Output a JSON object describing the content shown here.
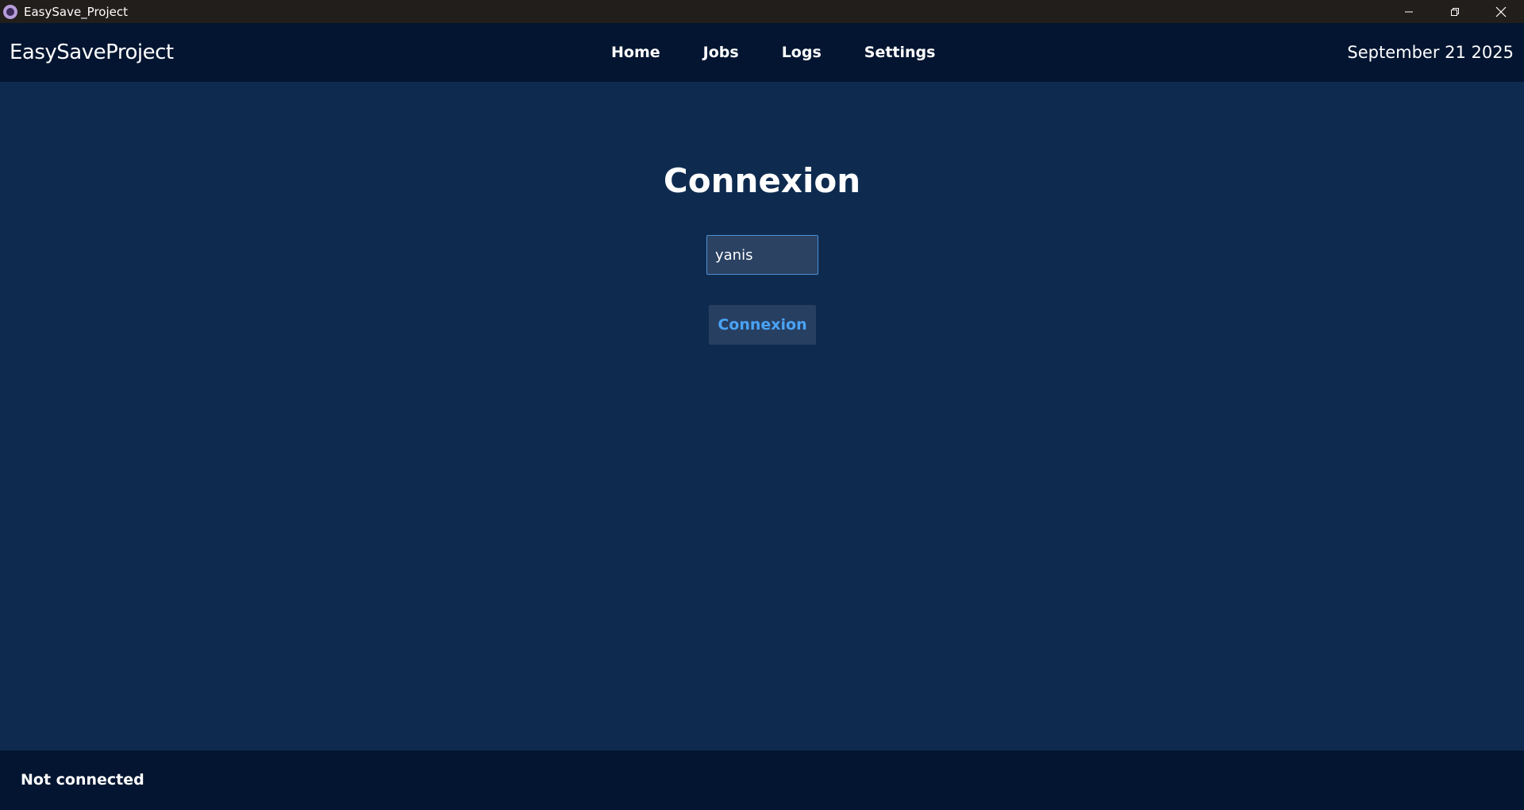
{
  "window": {
    "title": "EasySave_Project",
    "icon": "app-logo-icon",
    "controls": [
      "minimize-icon",
      "restore-icon",
      "close-icon"
    ]
  },
  "navbar": {
    "brand": "EasySaveProject",
    "links": [
      {
        "label": "Home"
      },
      {
        "label": "Jobs"
      },
      {
        "label": "Logs"
      },
      {
        "label": "Settings"
      }
    ],
    "date": "September 21 2025"
  },
  "login": {
    "title": "Connexion",
    "username_value": "yanis",
    "button_label": "Connexion"
  },
  "status": {
    "text": "Not connected"
  },
  "colors": {
    "titlebar_bg": "#221e1c",
    "navbar_bg": "#031531",
    "main_bg": "#0e2b4f",
    "accent": "#4aa3f5",
    "input_border": "#4c8fd6"
  }
}
